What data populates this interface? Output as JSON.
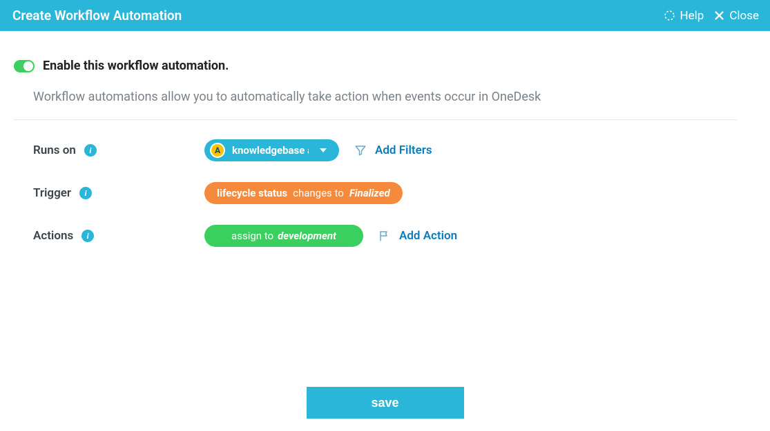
{
  "header": {
    "title": "Create Workflow Automation",
    "help": "Help",
    "close": "Close"
  },
  "enable": {
    "label": "Enable this workflow automation.",
    "on": true
  },
  "description": "Workflow automations allow you to automatically take action when events occur in OneDesk",
  "rows": {
    "runs_on": {
      "label": "Runs on",
      "pill_icon_letter": "A",
      "pill_label": "knowledgebase article",
      "side_link": "Add Filters"
    },
    "trigger": {
      "label": "Trigger",
      "seg1": "lifecycle status",
      "seg2": "changes to",
      "seg3": "Finalized"
    },
    "actions": {
      "label": "Actions",
      "seg1": "assign to",
      "seg2": "development",
      "side_link": "Add Action"
    }
  },
  "footer": {
    "save": "save"
  },
  "colors": {
    "brand": "#29b6d8",
    "orange": "#f58a3c",
    "green": "#3bcf60",
    "link": "#0a7bbd"
  }
}
